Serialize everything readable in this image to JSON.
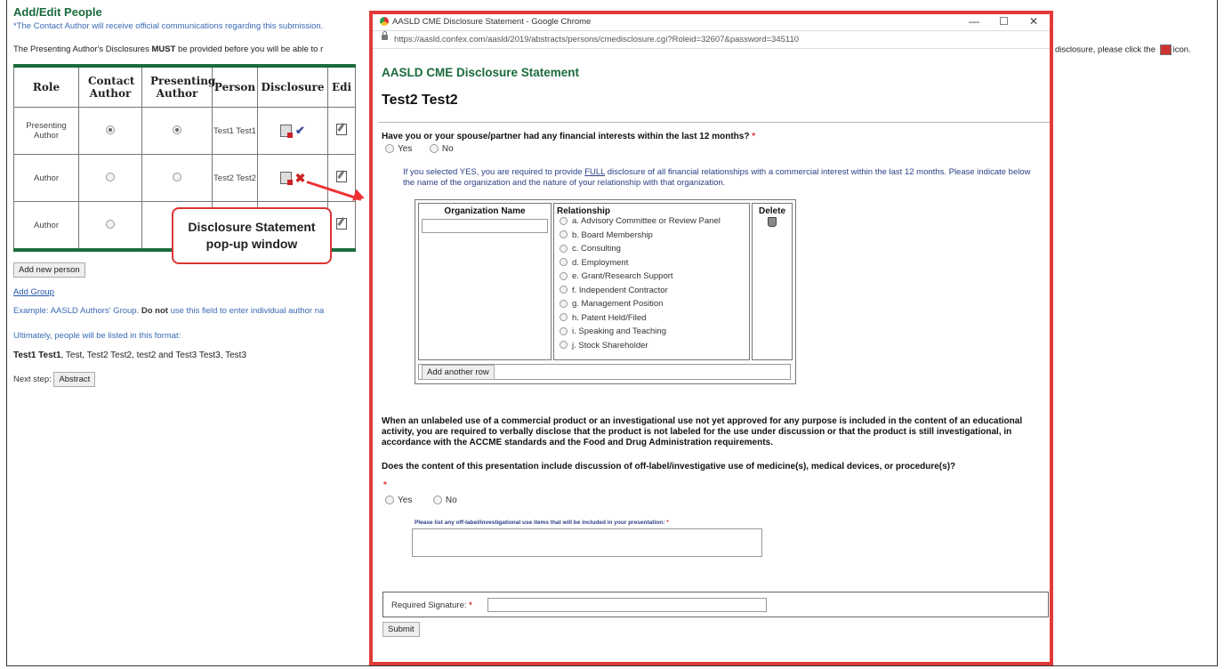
{
  "page": {
    "title": "Add/Edit People",
    "contact_note": "*The Contact Author will receive official communications regarding this submission.",
    "must_pre": "The Presenting Author's Disclosures ",
    "must_bold": "MUST",
    "must_post": " be provided before you will be able to r",
    "right_note_pre": "disclosure, please click the",
    "right_note_post": "icon."
  },
  "people_table": {
    "headers": [
      "Role",
      "Contact Author",
      "Presenting Author",
      "Person",
      "Disclosure",
      "Edi"
    ],
    "rows": [
      {
        "role": "Presenting Author",
        "person": "Test1 Test1",
        "contact_checked": true,
        "presenting_checked": true,
        "disclosure_status": "complete"
      },
      {
        "role": "Author",
        "person": "Test2 Test2",
        "contact_checked": false,
        "presenting_checked": false,
        "disclosure_status": "incomplete"
      },
      {
        "role": "Author",
        "person": "",
        "contact_checked": false,
        "presenting_checked": false,
        "disclosure_status": "none"
      }
    ]
  },
  "actions": {
    "add_person": "Add new person",
    "add_group": "Add Group",
    "example_pre": "Example: AASLD Authors' Group. ",
    "example_bold": "Do not",
    "example_post": " use this field to enter individual author na",
    "ultimately": "Ultimately, people will be listed in this format:",
    "listed_bold": "Test1 Test1",
    "listed_rest": ", Test, Test2 Test2, test2 and Test3 Test3, Test3",
    "next_step_label": "Next step:",
    "next_step_button": "Abstract"
  },
  "callout": {
    "line1": "Disclosure Statement",
    "line2": "pop-up window",
    "color": "#e23a3a"
  },
  "popup": {
    "window_title": "AASLD CME Disclosure Statement - Google Chrome",
    "url": "https://aasld.confex.com/aasld/2019/abstracts/persons/cmedisclosure.cgi?Roleid=32607&password=345110",
    "heading": "AASLD CME Disclosure Statement",
    "person_name": "Test2 Test2",
    "q_financial": "Have you or your spouse/partner had any financial interests within the last 12 months?",
    "yes": "Yes",
    "no": "No",
    "info_pre": "If you selected YES, you are required to provide ",
    "info_link": "FULL",
    "info_post": " disclosure of all financial relationships with a commercial interest within the last 12 months. Please indicate below the name of the organization and the nature of your relationship with that organization.",
    "org_header": "Organization Name",
    "relationship_header": "Relationship",
    "delete_header": "Delete",
    "relationships": [
      "a. Advisory Committee or Review Panel",
      "b. Board Membership",
      "c. Consulting",
      "d. Employment",
      "e. Grant/Research Support",
      "f. Independent Contractor",
      "g. Management Position",
      "h. Patent Held/Filed",
      "i. Speaking and Teaching",
      "j. Stock Shareholder"
    ],
    "add_row": "Add another row",
    "offlabel_para": "When an unlabeled use of a commercial product or an investigational use not yet approved for any purpose is included in the content of an educational activity, you are required to verbally disclose that the product is not labeled for the use under discussion or that the product is still investigational, in accordance with the ACCME standards and the Food and Drug Administration requirements.",
    "q_offlabel": "Does the content of this presentation include discussion of off-label/investigative use of medicine(s), medical devices, or procedure(s)?",
    "q_list": "Please list any off-label/investigational use items that will be included in your presentation:",
    "signature_label": "Required Signature:",
    "submit": "Submit",
    "required_mark": "*"
  }
}
